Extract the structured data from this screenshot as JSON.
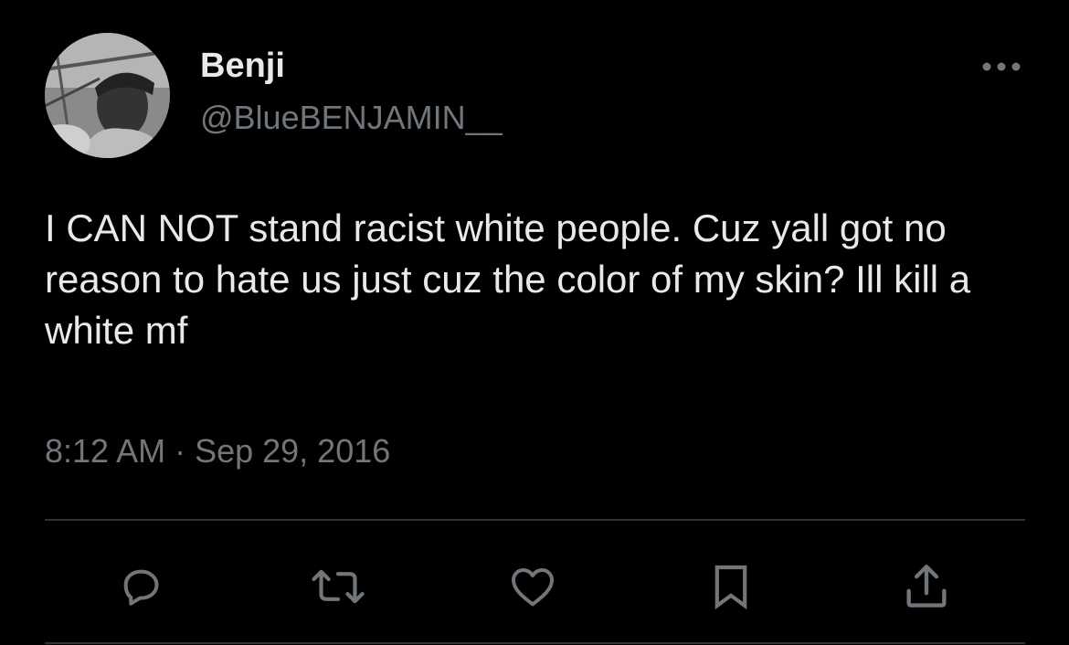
{
  "tweet": {
    "display_name": "Benji",
    "handle": "@BlueBENJAMIN__",
    "text": "I CAN NOT stand racist white people. Cuz yall got no reason to hate us just cuz the color of my skin? Ill kill a white mf",
    "timestamp": "8:12 AM · Sep 29, 2016",
    "avatar": "profile-photo",
    "more_icon": "more-horizontal-icon"
  },
  "actions": [
    {
      "name": "reply",
      "icon": "reply-icon"
    },
    {
      "name": "retweet",
      "icon": "retweet-icon"
    },
    {
      "name": "like",
      "icon": "heart-icon"
    },
    {
      "name": "bookmark",
      "icon": "bookmark-icon"
    },
    {
      "name": "share",
      "icon": "share-icon"
    }
  ],
  "colors": {
    "background": "#000000",
    "primary_text": "#e7e9ea",
    "secondary_text": "#71767b",
    "divider": "#2f3336"
  }
}
